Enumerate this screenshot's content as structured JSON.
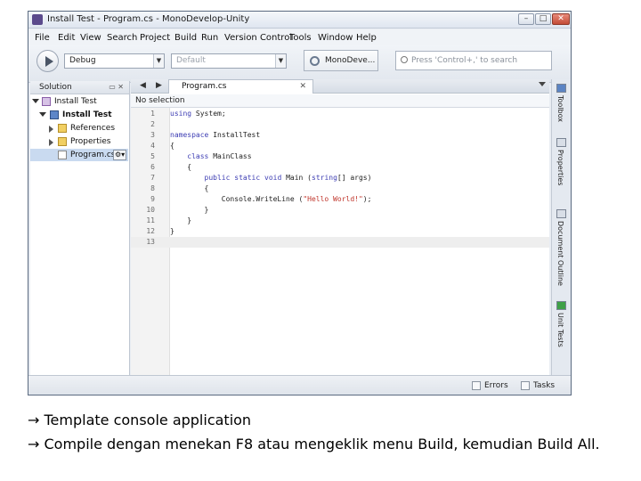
{
  "window": {
    "title": "Install Test - Program.cs - MonoDevelop-Unity",
    "controls": {
      "minimize": "–",
      "maximize": "□",
      "close": "✕"
    }
  },
  "menu": [
    "File",
    "Edit",
    "View",
    "Search",
    "Project",
    "Build",
    "Run",
    "Version Control",
    "Tools",
    "Window",
    "Help"
  ],
  "toolbar": {
    "configuration": "Debug",
    "platform_placeholder": "Default",
    "status": "MonoDeve...",
    "search_placeholder": "Press 'Control+,' to search"
  },
  "solution_pad": {
    "title": "Solution",
    "items": [
      {
        "label": "Install Test",
        "icon": "solution-icon",
        "expanded": true
      },
      {
        "label": "Install Test",
        "icon": "project-icon",
        "expanded": true,
        "bold": true
      },
      {
        "label": "References",
        "icon": "folder-icon",
        "expanded": false
      },
      {
        "label": "Properties",
        "icon": "folder-icon",
        "expanded": false
      },
      {
        "label": "Program.cs",
        "icon": "cs-file-icon",
        "selected": true
      }
    ]
  },
  "editor": {
    "tab_label": "Program.cs",
    "breadcrumb": "No selection",
    "lines": [
      {
        "n": "1",
        "text": "using System;"
      },
      {
        "n": "2",
        "text": ""
      },
      {
        "n": "3",
        "text": "namespace InstallTest"
      },
      {
        "n": "4",
        "text": "{"
      },
      {
        "n": "5",
        "text": "    class MainClass"
      },
      {
        "n": "6",
        "text": "    {"
      },
      {
        "n": "7",
        "text": "        public static void Main (string[] args)"
      },
      {
        "n": "8",
        "text": "        {"
      },
      {
        "n": "9",
        "text": "            Console.WriteLine (\"Hello World!\");"
      },
      {
        "n": "10",
        "text": "        }"
      },
      {
        "n": "11",
        "text": "    }"
      },
      {
        "n": "12",
        "text": "}"
      },
      {
        "n": "13",
        "text": ""
      }
    ]
  },
  "right_dock": [
    "Toolbox",
    "Properties",
    "Document Outline",
    "Unit Tests"
  ],
  "statusbar": {
    "errors": "Errors",
    "tasks": "Tasks"
  },
  "caption": {
    "line1": "→ Template console application",
    "line2": "→ Compile dengan menekan F8 atau mengeklik menu Build, kemudian Build All."
  }
}
